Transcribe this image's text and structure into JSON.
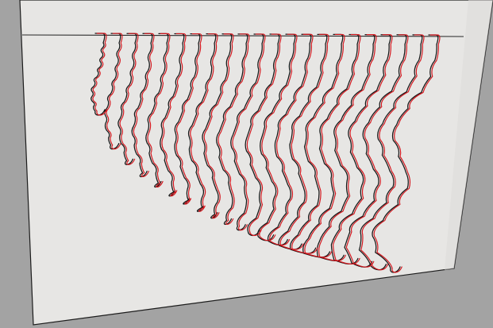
{
  "viewport": {
    "background_color": "#a3a3a3",
    "plate_color": "#e7e6e4",
    "outline_color": "#151515",
    "highlight_color": "#d4141b"
  },
  "scene": {
    "profile_count": 22,
    "views": [
      "outline",
      "highlight"
    ]
  }
}
